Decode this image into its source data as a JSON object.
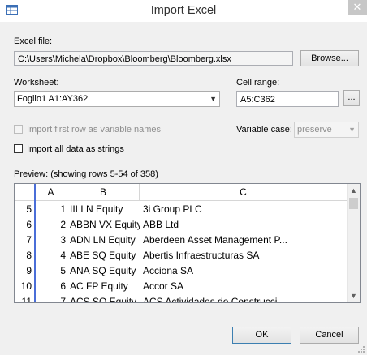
{
  "window": {
    "title": "Import Excel",
    "close_glyph": "✕",
    "app_icon": "spreadsheet-icon"
  },
  "excel_file": {
    "label": "Excel file:",
    "value": "C:\\Users\\Michela\\Dropbox\\Bloomberg\\Bloomberg.xlsx",
    "browse_label": "Browse..."
  },
  "worksheet": {
    "label": "Worksheet:",
    "value": "Foglio1 A1:AY362"
  },
  "cell_range": {
    "label": "Cell range:",
    "value": "A5:C362",
    "button_label": "..."
  },
  "options": {
    "first_row_label": "Import first row as variable names",
    "strings_label": "Import all data as strings",
    "variable_case_label": "Variable case:",
    "variable_case_value": "preserve"
  },
  "preview": {
    "label": "Preview: (showing rows 5-54 of 358)",
    "columns": [
      "A",
      "B",
      "C"
    ],
    "rows": [
      {
        "n": "5",
        "a": "1",
        "b": "III LN Equity",
        "c": "3i Group PLC"
      },
      {
        "n": "6",
        "a": "2",
        "b": "ABBN VX Equity",
        "c": "ABB Ltd"
      },
      {
        "n": "7",
        "a": "3",
        "b": "ADN LN Equity",
        "c": "Aberdeen Asset Management P..."
      },
      {
        "n": "8",
        "a": "4",
        "b": "ABE SQ Equity",
        "c": "Abertis Infraestructuras SA"
      },
      {
        "n": "9",
        "a": "5",
        "b": "ANA SQ Equity",
        "c": "Acciona SA"
      },
      {
        "n": "10",
        "a": "6",
        "b": "AC FP Equity",
        "c": "Accor SA"
      },
      {
        "n": "11",
        "a": "7",
        "b": "ACS SQ Equity",
        "c": "ACS Actividades de Construcci"
      }
    ]
  },
  "buttons": {
    "ok": "OK",
    "cancel": "Cancel"
  },
  "colors": {
    "frozen_line": "#4a6ed8",
    "close_bg": "#c7c7c7"
  }
}
